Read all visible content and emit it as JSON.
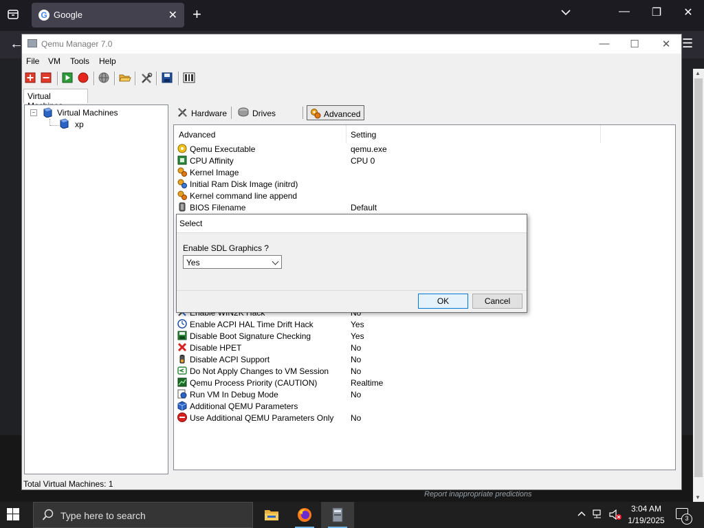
{
  "browser": {
    "tab_title": "Google",
    "favicon_letter": "G",
    "report_link": "Report inappropriate predictions"
  },
  "qemu": {
    "window_title": "Qemu Manager 7.0",
    "menu": [
      "File",
      "VM",
      "Tools",
      "Help"
    ],
    "toolbar_icons": [
      "add-vm-icon",
      "remove-vm-icon",
      "start-vm-icon",
      "stop-vm-icon",
      "globe-icon",
      "open-folder-icon",
      "tools-icon",
      "save-icon",
      "console-icon"
    ],
    "vm_panel_tab": "Virtual Machines",
    "tree": {
      "root": "Virtual Machines",
      "children": [
        "xp"
      ]
    },
    "detail_tabs": [
      "Hardware",
      "Drives",
      "Advanced"
    ],
    "active_tab": "Advanced",
    "list_headers": [
      "Advanced",
      "Setting"
    ],
    "rows": [
      {
        "name": "Qemu Executable",
        "value": "qemu.exe",
        "icon": "gear-icon"
      },
      {
        "name": "CPU Affinity",
        "value": "CPU 0",
        "icon": "cpu-icon"
      },
      {
        "name": "Kernel Image",
        "value": "",
        "icon": "gears-icon"
      },
      {
        "name": "Initial Ram Disk Image (initrd)",
        "value": "",
        "icon": "gears-icon"
      },
      {
        "name": "Kernel command line append",
        "value": "",
        "icon": "gears-icon"
      },
      {
        "name": "BIOS Filename",
        "value": "Default",
        "icon": "chip-icon"
      }
    ],
    "rows_lower": [
      {
        "name": "Enable WIN2K Hack",
        "value": "No",
        "icon": "hack-icon"
      },
      {
        "name": "Enable ACPI HAL Time Drift Hack",
        "value": "Yes",
        "icon": "clock-icon"
      },
      {
        "name": "Disable Boot Signature Checking",
        "value": "Yes",
        "icon": "disk-icon"
      },
      {
        "name": "Disable HPET",
        "value": "No",
        "icon": "red-x-icon"
      },
      {
        "name": "Disable ACPI Support",
        "value": "No",
        "icon": "battery-icon"
      },
      {
        "name": "Do Not Apply Changes to VM Session",
        "value": "No",
        "icon": "arrow-back-icon"
      },
      {
        "name": "Qemu Process Priority (CAUTION)",
        "value": "Realtime",
        "icon": "priority-icon"
      },
      {
        "name": "Run VM In Debug Mode",
        "value": "No",
        "icon": "debug-icon"
      },
      {
        "name": "Additional QEMU Parameters",
        "value": "",
        "icon": "cube-icon"
      },
      {
        "name": "Use Additional QEMU Parameters Only",
        "value": "No",
        "icon": "no-entry-icon"
      }
    ],
    "status": "Total Virtual Machines: 1"
  },
  "dialog": {
    "title": "Select",
    "prompt": "Enable SDL Graphics ?",
    "selected": "Yes",
    "ok": "OK",
    "cancel": "Cancel"
  },
  "taskbar": {
    "search_placeholder": "Type here to search",
    "time": "3:04 AM",
    "date": "1/19/2025",
    "notifications": "3"
  }
}
